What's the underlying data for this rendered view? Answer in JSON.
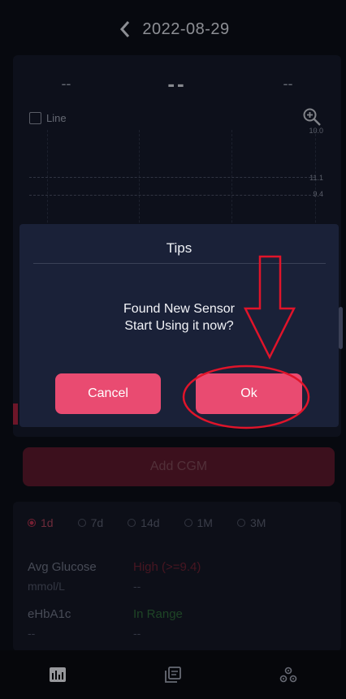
{
  "header": {
    "date": "2022-08-29"
  },
  "stats": {
    "left": "--",
    "center": "--",
    "right": "--"
  },
  "chart": {
    "line_label": "Line",
    "y_labels": [
      "10.0",
      "11.1",
      "9.4"
    ]
  },
  "add_cgm_label": "Add CGM",
  "periods": [
    {
      "label": "1d",
      "selected": true
    },
    {
      "label": "7d",
      "selected": false
    },
    {
      "label": "14d",
      "selected": false
    },
    {
      "label": "1M",
      "selected": false
    },
    {
      "label": "3M",
      "selected": false
    }
  ],
  "metrics": {
    "avg_glucose_label": "Avg Glucose",
    "avg_glucose_unit": "mmol/L",
    "high_label": "High  (>=9.4)",
    "high_value": "--",
    "ehba1c_label": "eHbA1c",
    "ehba1c_value": "--",
    "in_range_label": "In Range",
    "in_range_value": "--"
  },
  "dialog": {
    "title": "Tips",
    "message_line1": "Found New Sensor",
    "message_line2": "Start Using it now?",
    "cancel_label": "Cancel",
    "ok_label": "Ok"
  },
  "tabs": [
    {
      "icon": "chart-icon",
      "active": true
    },
    {
      "icon": "records-icon",
      "active": false
    },
    {
      "icon": "settings-icon",
      "active": false
    }
  ],
  "colors": {
    "accent": "#e94b71",
    "annotation": "#e0142a",
    "background": "#0c0f18",
    "dialog": "#1a2138"
  }
}
